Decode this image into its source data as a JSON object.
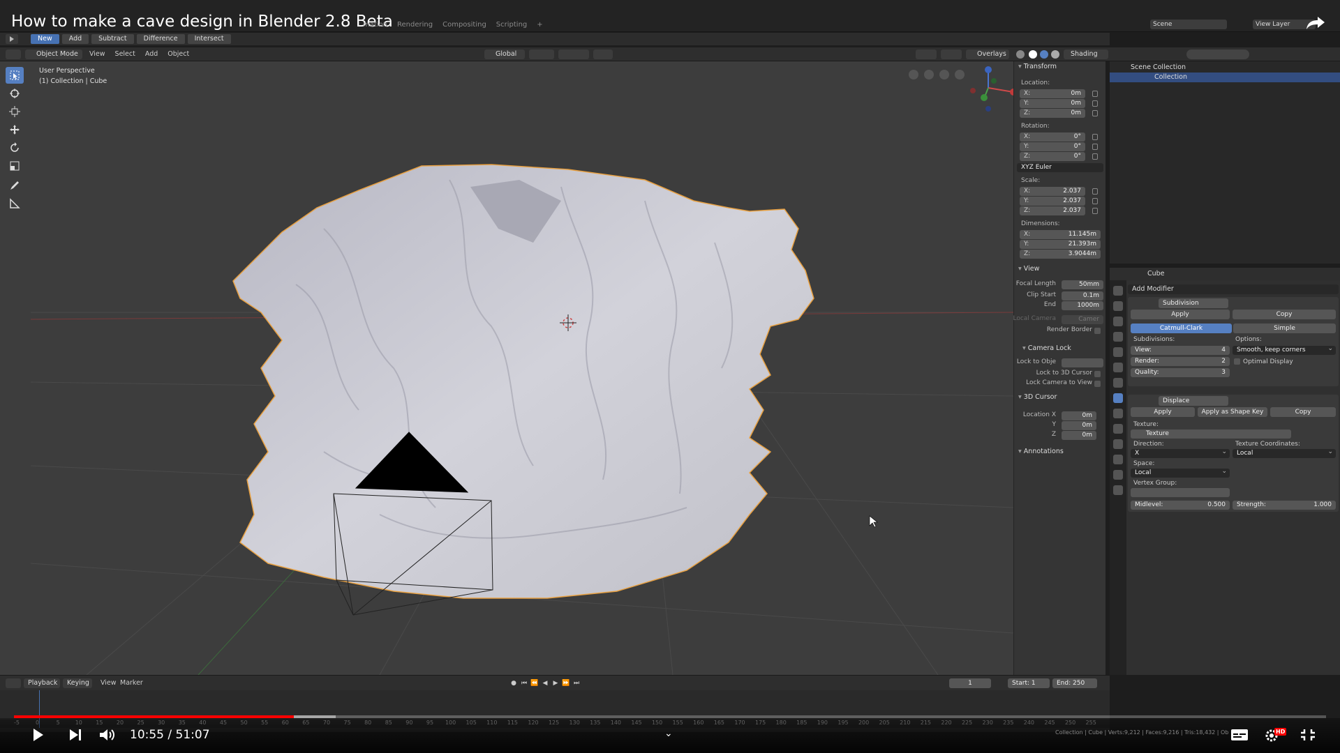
{
  "video": {
    "title": "How to make a cave design in Blender 2.8 Beta",
    "current_time": "10:55",
    "duration": "51:07",
    "progress_fraction": 0.2135,
    "buffered_fraction": 0.245,
    "hd_badge": "HD"
  },
  "topbar": {
    "workspaces": [
      "mation",
      "Rendering",
      "Compositing",
      "Scripting",
      "+"
    ],
    "scene": "Scene",
    "view_layer": "View Layer"
  },
  "boolbar": {
    "buttons": [
      "New",
      "Add",
      "Subtract",
      "Difference",
      "Intersect"
    ],
    "active": "New"
  },
  "viewport_header": {
    "mode": "Object Mode",
    "menus": [
      "View",
      "Select",
      "Add",
      "Object"
    ],
    "orientation": "Global",
    "overlays": "Overlays",
    "shading": "Shading"
  },
  "viewport": {
    "perspective": "User Perspective",
    "collection_info": "(1) Collection | Cube"
  },
  "npanel": {
    "transform_title": "Transform",
    "location_label": "Location:",
    "location": {
      "x": "0m",
      "y": "0m",
      "z": "0m"
    },
    "rotation_label": "Rotation:",
    "rotation": {
      "x": "0°",
      "y": "0°",
      "z": "0°"
    },
    "rotation_mode": "XYZ Euler",
    "scale_label": "Scale:",
    "scale": {
      "x": "2.037",
      "y": "2.037",
      "z": "2.037"
    },
    "dimensions_label": "Dimensions:",
    "dimensions": {
      "x": "11.145m",
      "y": "21.393m",
      "z": "3.9044m"
    },
    "axis_labels": {
      "x": "X:",
      "y": "Y:",
      "z": "Z:"
    },
    "view_title": "View",
    "focal_length_label": "Focal Length",
    "focal_length": "50mm",
    "clip_start_label": "Clip Start",
    "clip_start": "0.1m",
    "clip_end_label": "End",
    "clip_end": "1000m",
    "local_camera_label": "Local Camera",
    "local_camera_value": "Camer",
    "render_border_label": "Render Border",
    "camera_lock_title": "Camera Lock",
    "lock_to_object_label": "Lock to Obje",
    "lock_to_cursor_label": "Lock to 3D Cursor",
    "lock_camera_label": "Lock Camera to View",
    "cursor_title": "3D Cursor",
    "cursor_loc_label": "Location X",
    "cursor_y_label": "Y",
    "cursor_z_label": "Z",
    "cursor": {
      "x": "0m",
      "y": "0m",
      "z": "0m"
    },
    "annotations_title": "Annotations"
  },
  "outliner": {
    "rows": [
      "Scene Collection",
      "Collection"
    ]
  },
  "properties": {
    "object_name": "Cube",
    "add_modifier": "Add Modifier",
    "subdivision": {
      "name": "Subdivision",
      "apply": "Apply",
      "copy": "Copy",
      "algorithms": [
        "Catmull-Clark",
        "Simple"
      ],
      "active_algorithm": "Catmull-Clark",
      "subdivisions_label": "Subdivisions:",
      "view_label": "View:",
      "view": "4",
      "render_label": "Render:",
      "render": "2",
      "quality_label": "Quality:",
      "quality": "3",
      "options_label": "Options:",
      "options_value": "Smooth, keep corners",
      "optimal_display": "Optimal Display"
    },
    "displace": {
      "name": "Displace",
      "apply": "Apply",
      "apply_shape_key": "Apply as Shape Key",
      "copy": "Copy",
      "texture_label": "Texture:",
      "texture": "Texture",
      "direction_label": "Direction:",
      "direction": "X",
      "tex_coords_label": "Texture Coordinates:",
      "tex_coords": "Local",
      "space_label": "Space:",
      "space": "Local",
      "vertex_group_label": "Vertex Group:",
      "midlevel_label": "Midlevel:",
      "midlevel": "0.500",
      "strength_label": "Strength:",
      "strength": "1.000"
    }
  },
  "timeline": {
    "menus": [
      "Playback",
      "Keying",
      "View",
      "Marker"
    ],
    "current_frame": "1",
    "start_label": "Start:",
    "start": "1",
    "end_label": "End:",
    "end": "250",
    "ruler_ticks": [
      "-5",
      "0",
      "5",
      "10",
      "15",
      "20",
      "25",
      "30",
      "35",
      "40",
      "45",
      "50",
      "55",
      "60",
      "65",
      "70",
      "75",
      "80",
      "85",
      "90",
      "95",
      "100",
      "105",
      "110",
      "115",
      "120",
      "125",
      "130",
      "135",
      "140",
      "145",
      "150",
      "155",
      "160",
      "165",
      "170",
      "175",
      "180",
      "185",
      "190",
      "195",
      "200",
      "205",
      "210",
      "215",
      "220",
      "225",
      "230",
      "235",
      "240",
      "245",
      "250",
      "255"
    ]
  },
  "status": {
    "stats": "Collection | Cube | Verts:9,212 | Faces:9,216 | Tris:18,432 | Ob"
  }
}
